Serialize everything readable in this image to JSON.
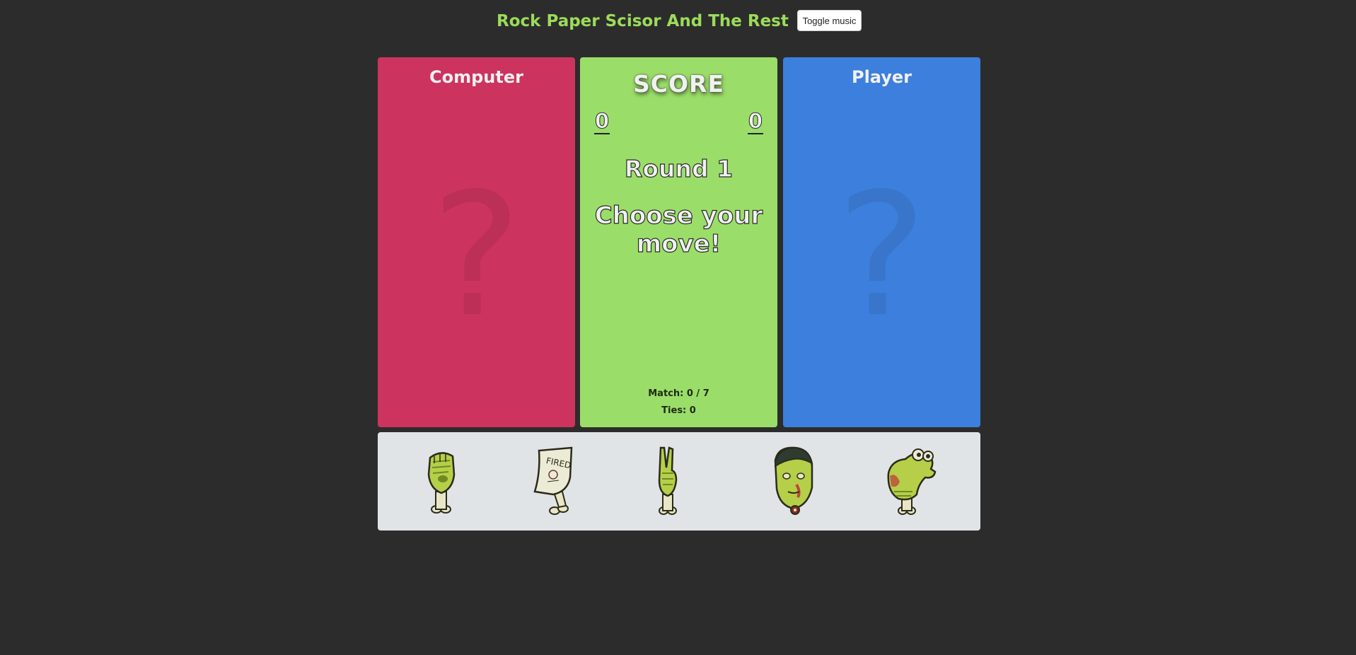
{
  "header": {
    "title": "Rock Paper Scisor And The Rest",
    "music_button": "Toggle music"
  },
  "computer": {
    "label": "Computer",
    "placeholder": "?"
  },
  "player": {
    "label": "Player",
    "placeholder": "?"
  },
  "score": {
    "title": "SCORE",
    "computer": "0",
    "player": "0",
    "round": "Round 1",
    "message": "Choose your move!",
    "match": "Match: 0 / 7",
    "ties": "Ties: 0"
  },
  "moves": [
    {
      "name": "rock",
      "icon": "zombie-fist-icon"
    },
    {
      "name": "paper",
      "icon": "fired-paper-icon",
      "text": "FIRED"
    },
    {
      "name": "scissors",
      "icon": "peace-hand-icon"
    },
    {
      "name": "spock",
      "icon": "zombie-head-icon"
    },
    {
      "name": "lizard",
      "icon": "lizard-hand-icon"
    }
  ],
  "colors": {
    "background": "#2d2c2c",
    "title": "#9bdc5a",
    "computer_panel": "#cc335e",
    "score_panel": "#9bdd69",
    "player_panel": "#3d7fdd",
    "moves_bar": "#e1e4e7",
    "zombie_skin": "#b5cf48"
  }
}
